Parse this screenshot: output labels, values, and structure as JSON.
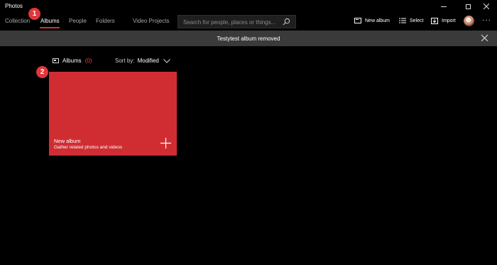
{
  "window": {
    "title": "Photos"
  },
  "nav": {
    "tabs": [
      {
        "label": "Collection"
      },
      {
        "label": "Albums"
      },
      {
        "label": "People"
      },
      {
        "label": "Folders"
      },
      {
        "label": "Video Projects"
      }
    ],
    "active_tab": "Albums",
    "search": {
      "placeholder": "Search for people, places or things..."
    },
    "actions": {
      "new_album": "New album",
      "select": "Select",
      "import": "Import"
    }
  },
  "notification": {
    "text": "Testytest album removed"
  },
  "albums": {
    "heading": "Albums",
    "count": "(0)",
    "sort_label": "Sort by:",
    "sort_value": "Modified"
  },
  "new_album_card": {
    "title": "New album",
    "subtitle": "Gather related photos and videos",
    "color": "#d02d33"
  },
  "annotations": {
    "badge1": "1",
    "badge2": "2"
  },
  "colors": {
    "accent": "#d13438",
    "background": "#000000",
    "notification_bar": "#3a3a3a"
  }
}
